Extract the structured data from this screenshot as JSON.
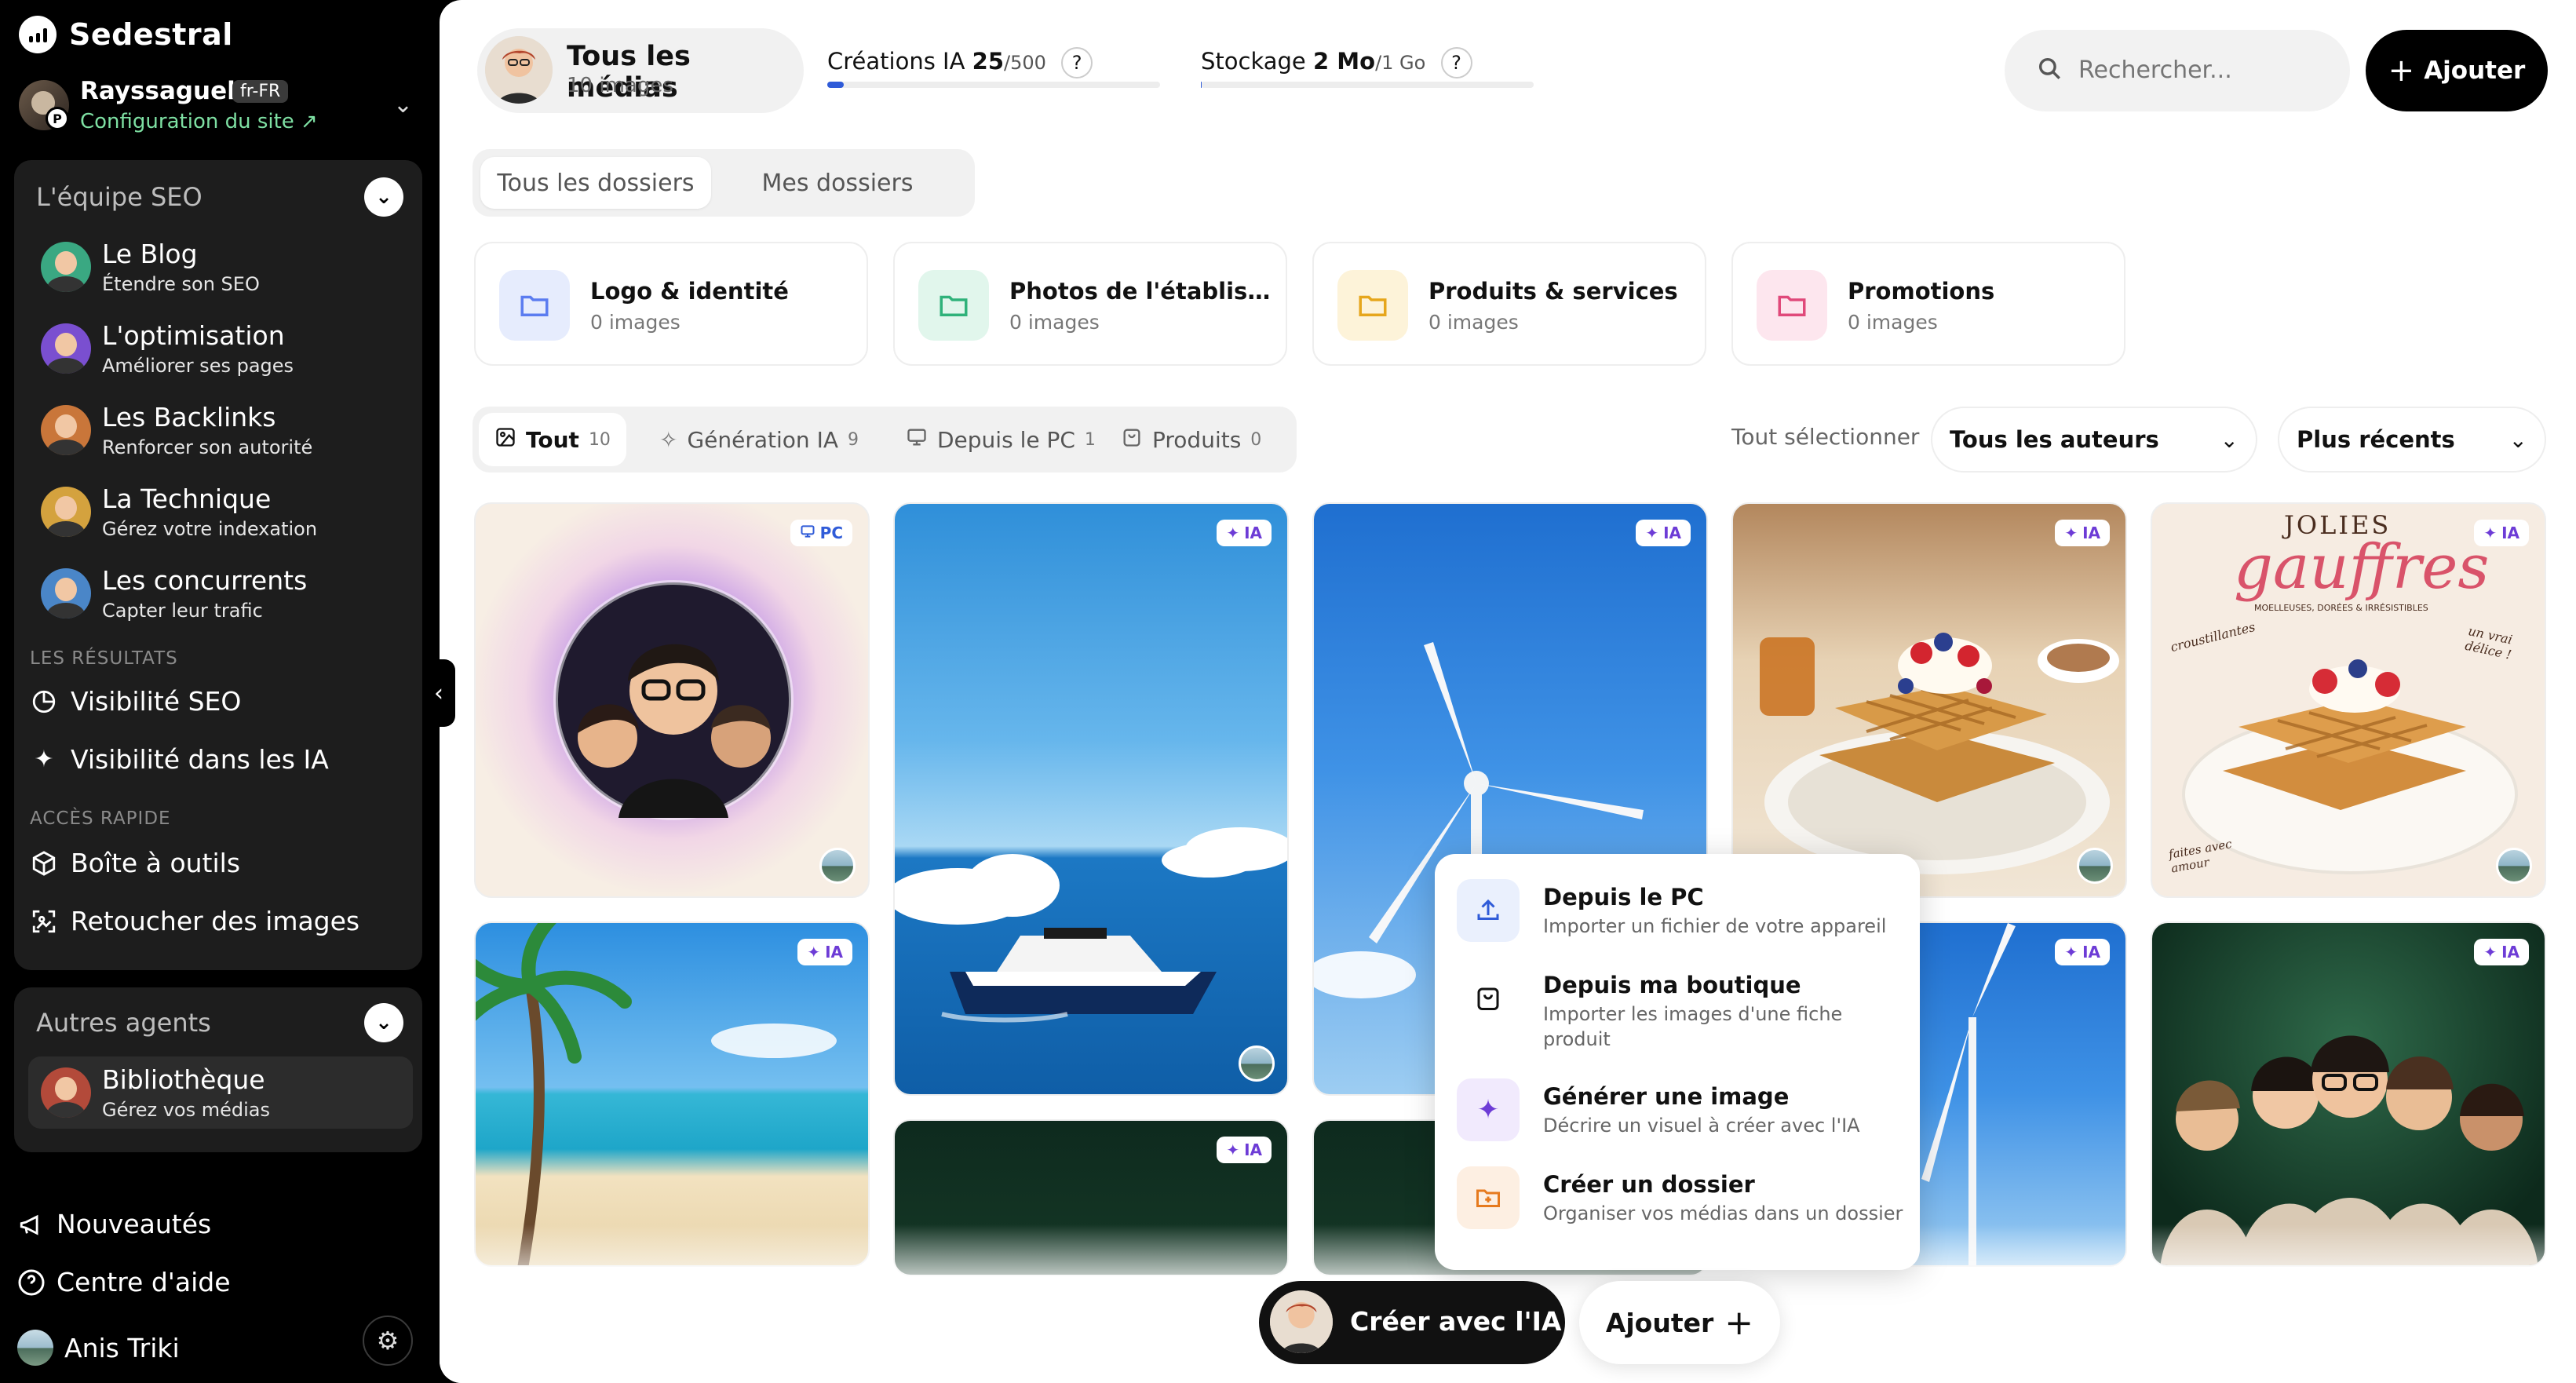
{
  "app": {
    "brand": "Sedestral"
  },
  "site": {
    "name": "Rayssaguel",
    "lang": "fr-FR",
    "config_link": "Configuration du site ↗",
    "badge": "P"
  },
  "team": {
    "title": "L'équipe SEO",
    "agents": [
      {
        "title": "Le Blog",
        "subtitle": "Étendre son SEO"
      },
      {
        "title": "L'optimisation",
        "subtitle": "Améliorer ses pages"
      },
      {
        "title": "Les Backlinks",
        "subtitle": "Renforcer son autorité"
      },
      {
        "title": "La Technique",
        "subtitle": "Gérez votre indexation"
      },
      {
        "title": "Les concurrents",
        "subtitle": "Capter leur trafic"
      }
    ],
    "results_label": "LES RÉSULTATS",
    "results": [
      {
        "label": "Visibilité SEO",
        "icon": "pie-chart-icon"
      },
      {
        "label": "Visibilité dans les IA",
        "icon": "sparkle-icon"
      }
    ],
    "quick_label": "ACCÈS RAPIDE",
    "quick": [
      {
        "label": "Boîte à outils",
        "icon": "box-icon"
      },
      {
        "label": "Retoucher des images",
        "icon": "image-edit-icon"
      }
    ]
  },
  "others": {
    "title": "Autres agents",
    "agents": [
      {
        "title": "Bibliothèque",
        "subtitle": "Gérez vos médias"
      }
    ]
  },
  "bottom_nav": {
    "news": "Nouveautés",
    "help": "Centre d'aide",
    "user": "Anis Triki"
  },
  "header": {
    "library_title": "Tous les médias",
    "library_count": "10 images",
    "ai_quota": {
      "label": "Créations IA",
      "value": "25",
      "max": "/500",
      "help": "?",
      "fraction": 0.05
    },
    "storage": {
      "label": "Stockage",
      "value": "2 Mo",
      "max": "/1 Go",
      "help": "?",
      "fraction": 0.002
    },
    "search_placeholder": "Rechercher...",
    "add_label": "Ajouter"
  },
  "folder_tabs": [
    "Tous les dossiers",
    "Mes dossiers"
  ],
  "folders": [
    {
      "name": "Logo & identité",
      "count": "0 images",
      "color": "#5b7cf0",
      "bg": "#e6ecfd"
    },
    {
      "name": "Photos de l'établisse...",
      "count": "0 images",
      "color": "#2fb27a",
      "bg": "#e1f6ec"
    },
    {
      "name": "Produits & services",
      "count": "0 images",
      "color": "#e6a61c",
      "bg": "#fdf3d9"
    },
    {
      "name": "Promotions",
      "count": "0 images",
      "color": "#e0497a",
      "bg": "#fde6ee"
    }
  ],
  "filters": [
    {
      "label": "Tout",
      "count": "10",
      "icon": "image-icon"
    },
    {
      "label": "Génération IA",
      "count": "9",
      "icon": "sparkle-icon"
    },
    {
      "label": "Depuis le PC",
      "count": "1",
      "icon": "monitor-icon"
    },
    {
      "label": "Produits",
      "count": "0",
      "icon": "bag-icon"
    }
  ],
  "select_all": "Tout sélectionner",
  "author_filter": "Tous les auteurs",
  "sort_filter": "Plus récents",
  "badges": {
    "pc": "PC",
    "ai": "IA"
  },
  "waffle_poster": {
    "title1": "JOLIES",
    "title2": "gauffres",
    "tagline": "MOELLEUSES, DORÉES & IRRÉSISTIBLES",
    "note1": "croustillantes",
    "note2": "un vrai délice !",
    "note3": "faites avec amour"
  },
  "add_menu": [
    {
      "title": "Depuis le PC",
      "subtitle": "Importer un fichier de votre appareil",
      "icon": "upload-icon"
    },
    {
      "title": "Depuis ma boutique",
      "subtitle": "Importer les images d'une fiche produit",
      "icon": "bag-icon"
    },
    {
      "title": "Générer une image",
      "subtitle": "Décrire un visuel à créer avec l'IA",
      "icon": "sparkle-icon"
    },
    {
      "title": "Créer un dossier",
      "subtitle": "Organiser vos médias dans un dossier",
      "icon": "folder-plus-icon"
    }
  ],
  "actions": {
    "create_ai": "Créer avec l'IA",
    "add": "Ajouter"
  }
}
